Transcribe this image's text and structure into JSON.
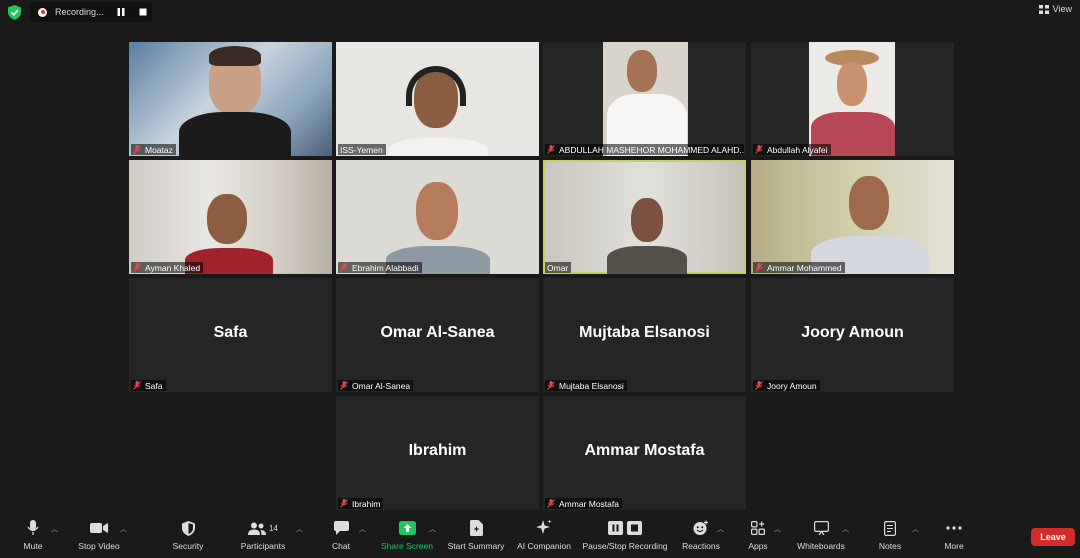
{
  "topbar": {
    "recording_label": "Recording...",
    "view_label": "View"
  },
  "participants": [
    {
      "name": "Moataz",
      "video": true
    },
    {
      "name": "ISS-Yemen",
      "video": true
    },
    {
      "name": "ABDULLAH MASHEHOR MOHAMMED ALAHD...",
      "video": true
    },
    {
      "name": "Abdullah Alyafei",
      "video": true
    },
    {
      "name": "Ayman Khaled",
      "video": true
    },
    {
      "name": "Ebrahim Alabbadi",
      "video": true
    },
    {
      "name": "Omar",
      "video": true,
      "active_speaker": true
    },
    {
      "name": "Ammar Mohammed",
      "video": true
    },
    {
      "name": "Safa",
      "display": "Safa",
      "video": false
    },
    {
      "name": "Omar Al-Sanea",
      "display": "Omar Al-Sanea",
      "video": false
    },
    {
      "name": "Mujtaba Elsanosi",
      "display": "Mujtaba Elsanosi",
      "video": false
    },
    {
      "name": "Joory Amoun",
      "display": "Joory Amoun",
      "video": false
    },
    {
      "name": "Ibrahim",
      "display": "Ibrahim",
      "video": false
    },
    {
      "name": "Ammar Mostafa",
      "display": "Ammar Mostafa",
      "video": false
    }
  ],
  "toolbar": {
    "mute": "Mute",
    "stop_video": "Stop Video",
    "security": "Security",
    "participants": "Participants",
    "participant_count": "14",
    "chat": "Chat",
    "share_screen": "Share Screen",
    "start_summary": "Start Summary",
    "ai_companion": "AI Companion",
    "pause_stop_recording": "Pause/Stop Recording",
    "reactions": "Reactions",
    "apps": "Apps",
    "whiteboards": "Whiteboards",
    "notes": "Notes",
    "more": "More",
    "leave": "Leave"
  },
  "colors": {
    "background": "#1a1a1a",
    "tile": "#252525",
    "active_border": "#c6d15a",
    "share_green": "#22c55e",
    "leave_red": "#d42b2b",
    "muted_red": "#e5484d"
  }
}
